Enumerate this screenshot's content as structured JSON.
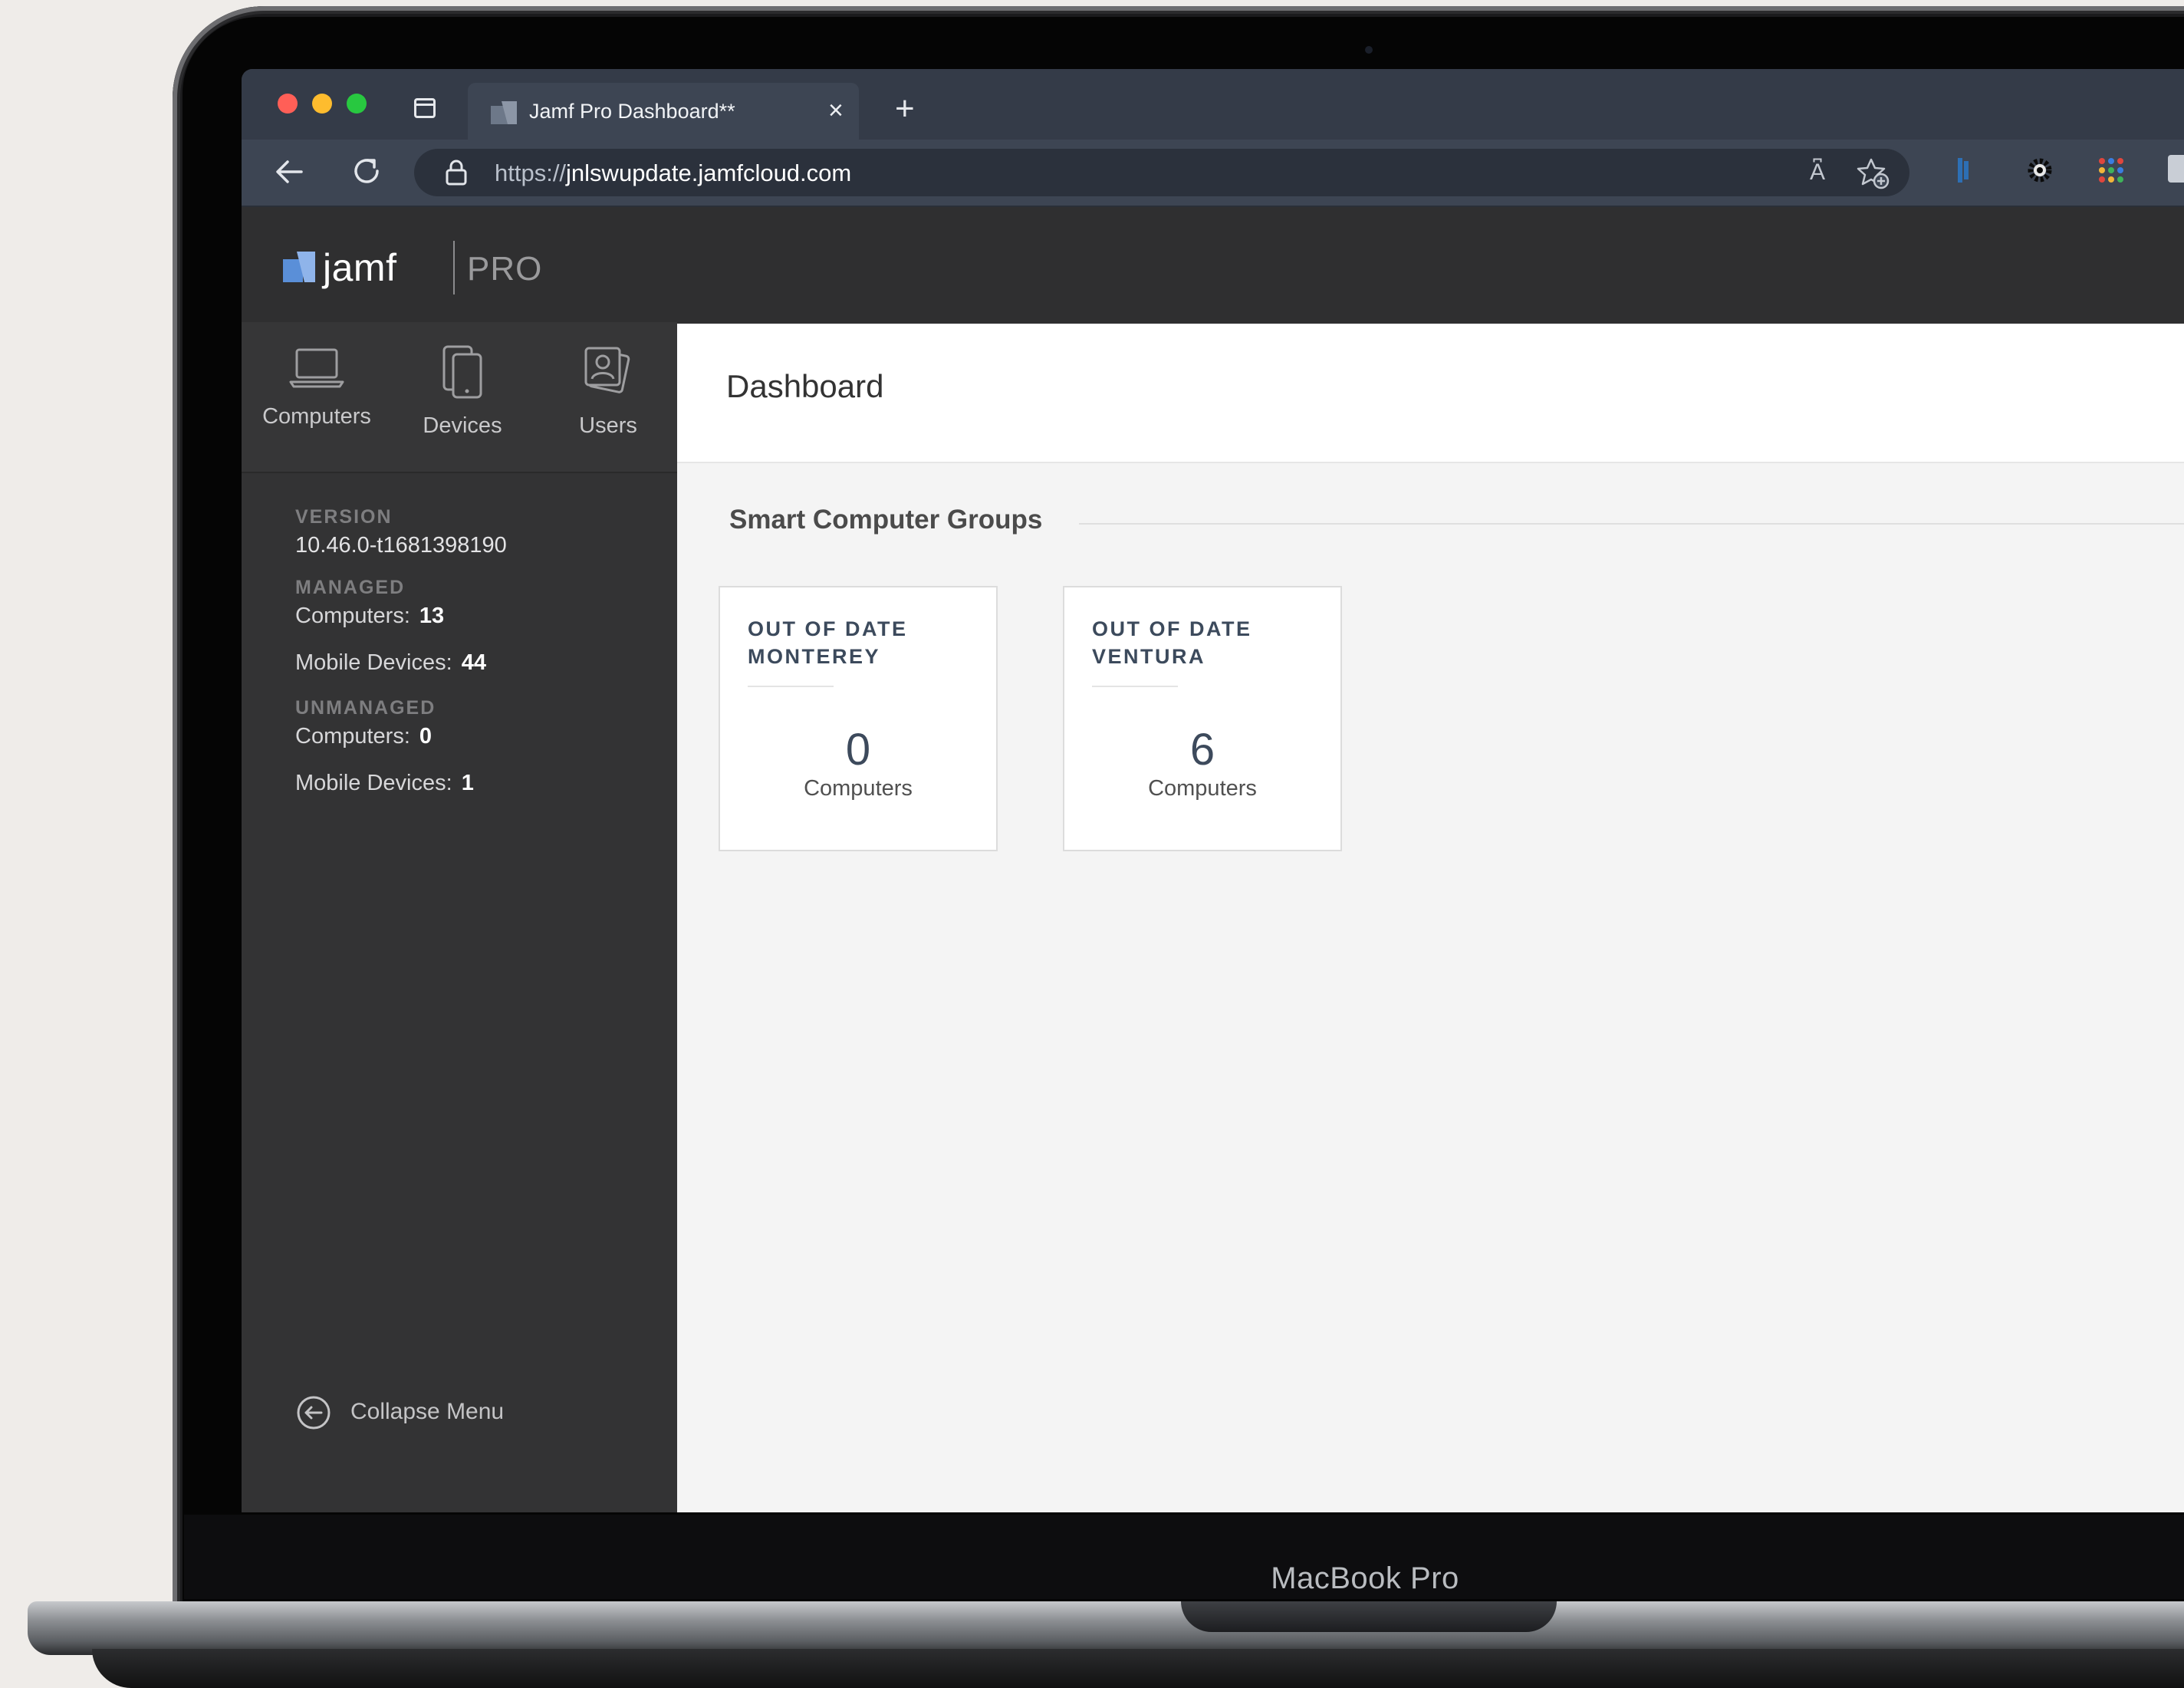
{
  "browser": {
    "tab_title": "Jamf Pro Dashboard**",
    "tab_close": "×",
    "new_tab": "+",
    "url_prefix": "https://",
    "url_host": "jnlswupdate.jamfcloud.com",
    "read_aloud": "A͆"
  },
  "brand": {
    "name": "jamf",
    "product": "PRO",
    "accent": "#5a8fd8"
  },
  "nav": [
    {
      "label": "Computers",
      "icon": "laptop-icon"
    },
    {
      "label": "Devices",
      "icon": "mobile-devices-icon"
    },
    {
      "label": "Users",
      "icon": "users-icon"
    }
  ],
  "sidebar": {
    "version_heading": "VERSION",
    "version_value": "10.46.0-t1681398190",
    "managed_heading": "MANAGED",
    "managed_computers_label": "Computers:",
    "managed_computers_value": "13",
    "managed_mobile_label": "Mobile Devices:",
    "managed_mobile_value": "44",
    "unmanaged_heading": "UNMANAGED",
    "unmanaged_computers_label": "Computers:",
    "unmanaged_computers_value": "0",
    "unmanaged_mobile_label": "Mobile Devices:",
    "unmanaged_mobile_value": "1",
    "collapse_label": "Collapse Menu"
  },
  "main": {
    "page_title": "Dashboard",
    "section_title": "Smart Computer Groups",
    "cards": [
      {
        "title": "OUT OF DATE MONTEREY",
        "count": "0",
        "unit": "Computers"
      },
      {
        "title": "OUT OF DATE VENTURA",
        "count": "6",
        "unit": "Computers"
      }
    ]
  },
  "device": {
    "label": "MacBook Pro"
  }
}
